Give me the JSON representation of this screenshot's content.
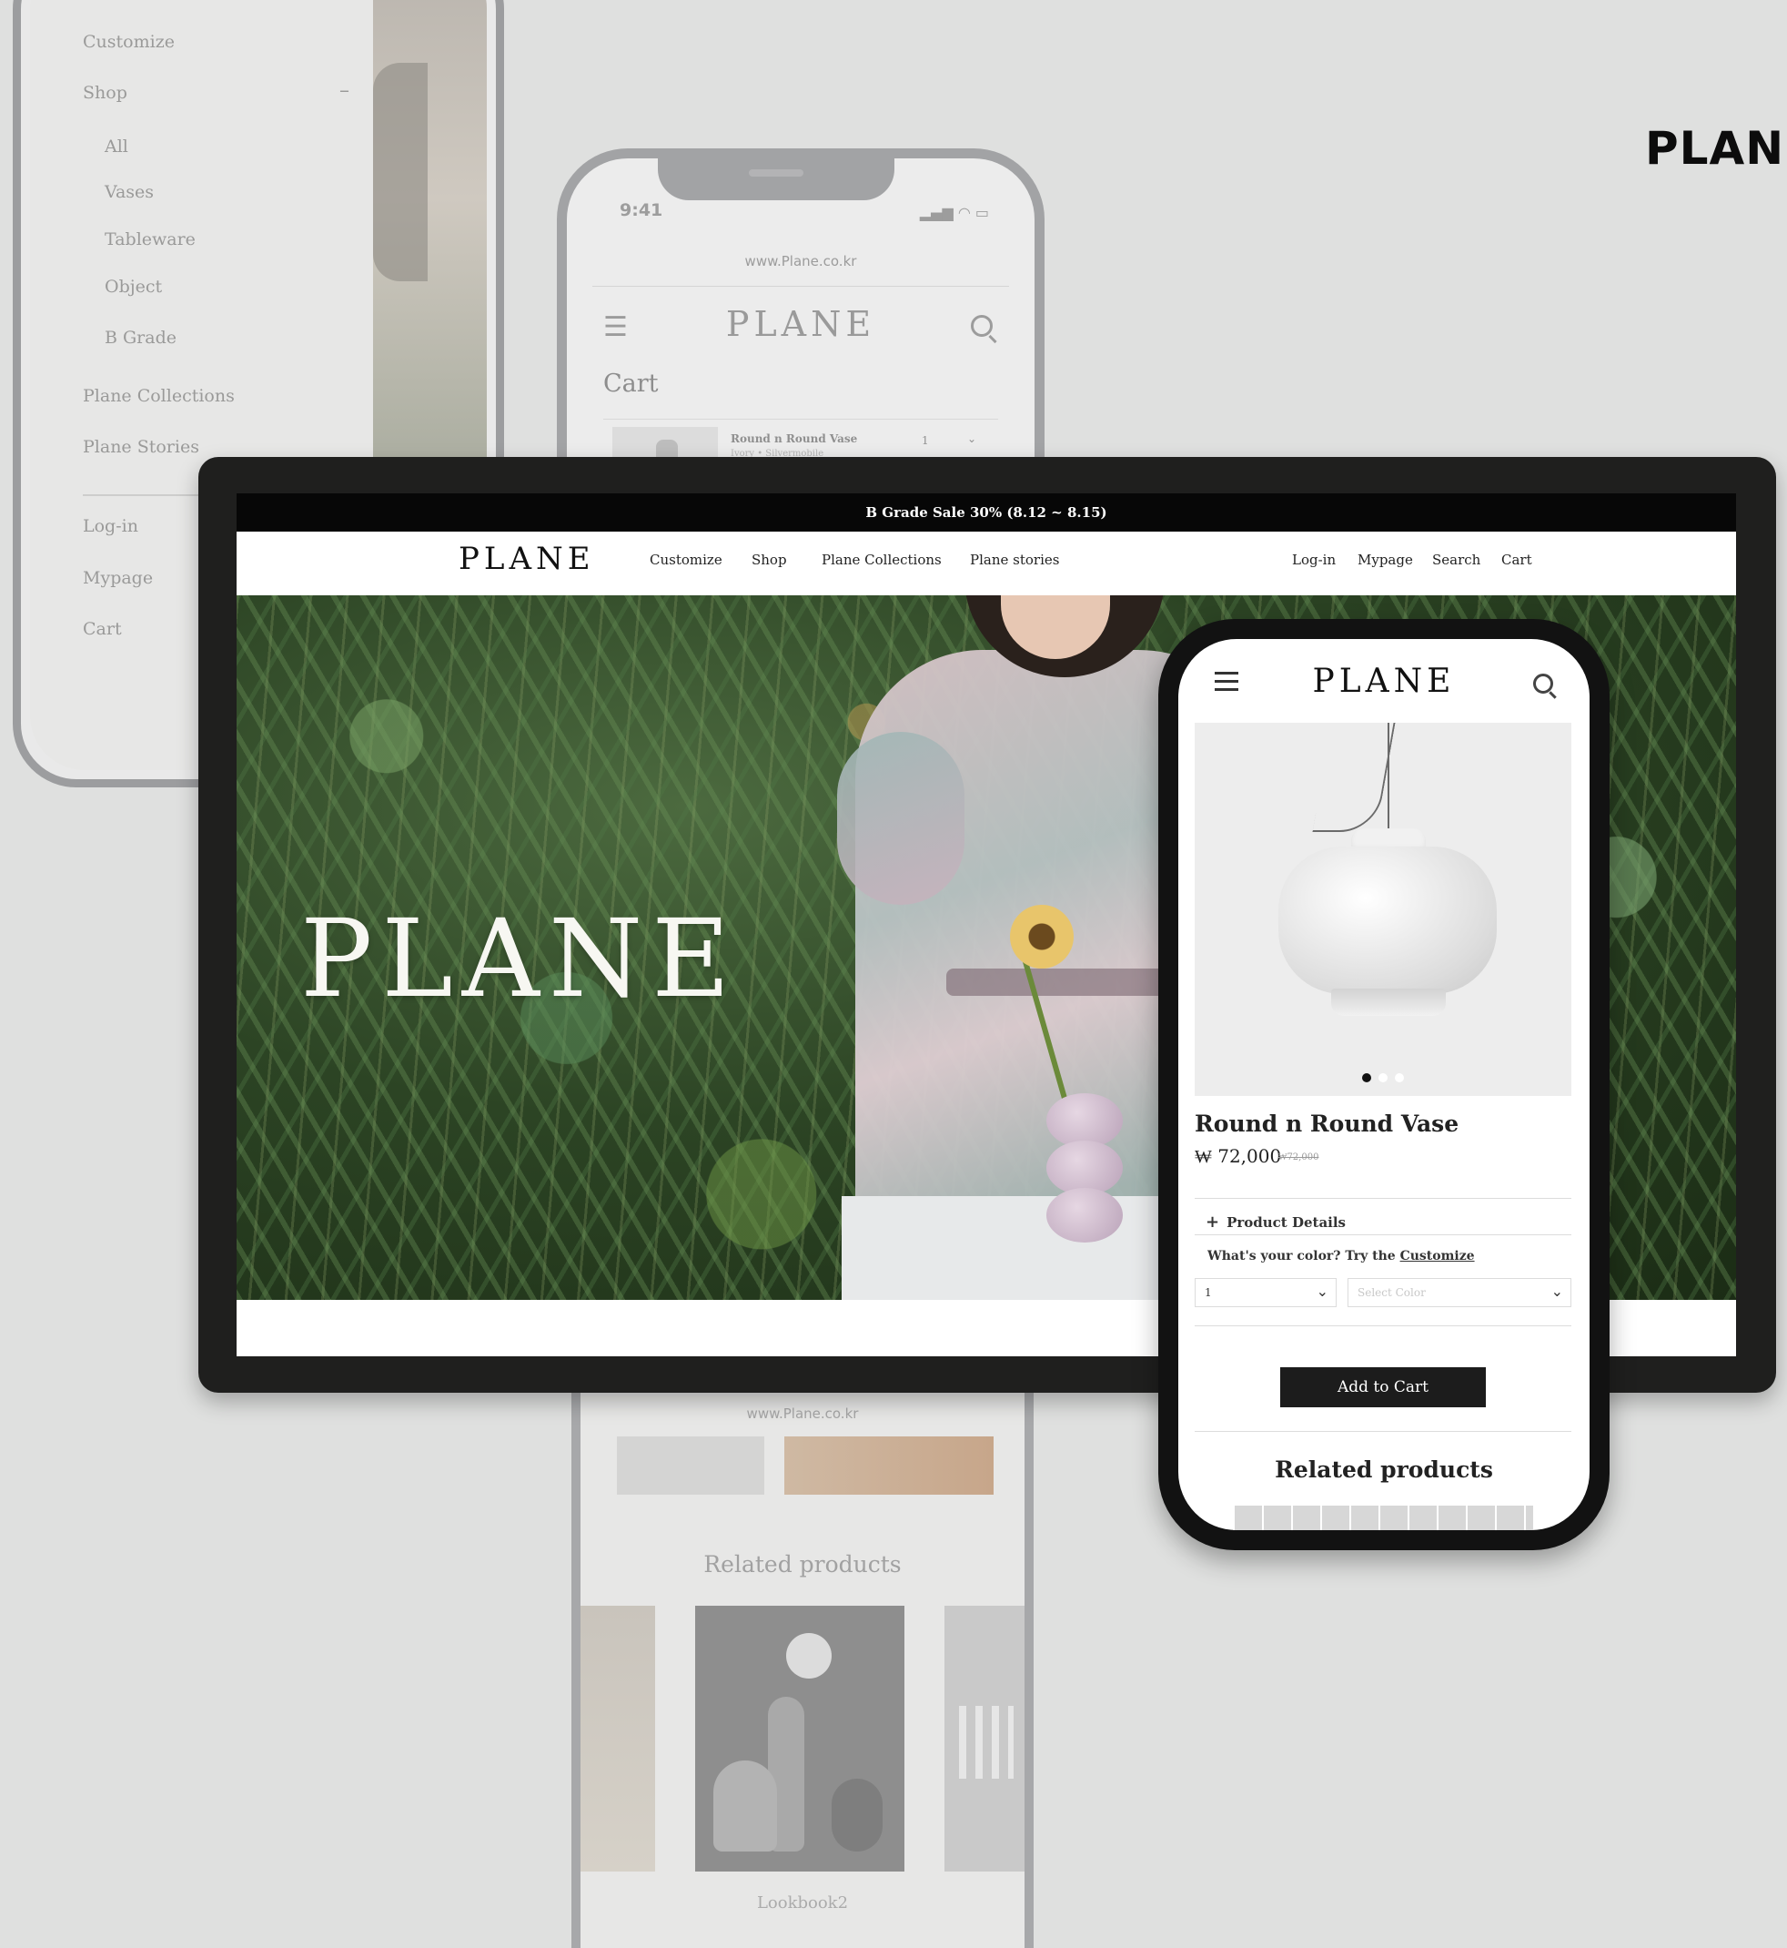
{
  "corner_brand": "PLAN",
  "menu_phone": {
    "items": [
      {
        "label": "Customize"
      },
      {
        "label": "Shop"
      },
      {
        "label": "All"
      },
      {
        "label": "Vases"
      },
      {
        "label": "Tableware"
      },
      {
        "label": "Object"
      },
      {
        "label": "B Grade"
      },
      {
        "label": "Plane Collections"
      },
      {
        "label": "Plane Stories"
      },
      {
        "label": "Log-in"
      },
      {
        "label": "Mypage"
      },
      {
        "label": "Cart"
      }
    ],
    "collapse_symbol": "–"
  },
  "cart_phone": {
    "time": "9:41",
    "url": "www.Plane.co.kr",
    "brand": "PLANE",
    "page_title": "Cart",
    "item": {
      "name": "Round n Round Vase",
      "option": "Ivory • Silvermobile",
      "qty": "1"
    }
  },
  "bottom_phone": {
    "url": "www.Plane.co.kr",
    "related_title": "Related products",
    "card_label": "Lookbook2"
  },
  "desktop": {
    "promo": "B Grade Sale 30% (8.12 ~ 8.15)",
    "logo": "PLANE",
    "nav_left": [
      "Customize",
      "Shop",
      "Plane Collections",
      "Plane stories"
    ],
    "nav_right": [
      "Log-in",
      "Mypage",
      "Search",
      "Cart"
    ],
    "hero_title": "PLANE"
  },
  "product_phone": {
    "logo": "PLANE",
    "product_name": "Round n Round Vase",
    "price": "₩ 72,000",
    "old_price": "₩72,000",
    "details_label": "Product Details",
    "cta_text": "What's your color? Try the ",
    "cta_link": "Customize",
    "qty_value": "1",
    "color_placeholder": "Select Color",
    "add_to_cart": "Add to Cart",
    "related_title": "Related products",
    "carousel_pages": 3,
    "carousel_active": 1
  }
}
